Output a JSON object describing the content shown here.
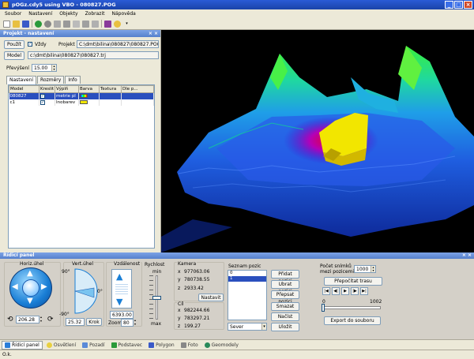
{
  "window": {
    "title": "pOGz.cdy5 using VBO - 080827.POG",
    "controls": [
      "_",
      "□",
      "×"
    ]
  },
  "menu": [
    "Soubor",
    "Nastavení",
    "Objekty",
    "Zobrazit",
    "Nápověda"
  ],
  "project_panel": {
    "title": "Projekt - nastavení",
    "use_button": "Použít",
    "always_label": "Vždy",
    "always_checked": true,
    "project_label": "Projekt",
    "project_path": "C:\\dmt\\bilina\\080827\\080827.POG",
    "model_button": "Model",
    "model_path": "c:\\dmt\\bilina\\080827\\080827.trj",
    "exaggeration_label": "Převýšení",
    "exaggeration_value": "15.00",
    "tabs": [
      "Nastavení",
      "Rozměry",
      "Info"
    ],
    "table": {
      "headers": [
        "Model",
        "Kreslit",
        "Výplň",
        "Barva",
        "Textura",
        "Dle p..."
      ],
      "rows": [
        {
          "model": "080827",
          "draw": true,
          "fill": "metrie pl",
          "color": "rainbow",
          "selected": true
        },
        {
          "model": "c1",
          "draw": true,
          "fill": "Inobarev",
          "color": "#f2e600",
          "selected": false
        }
      ]
    }
  },
  "control_panel": {
    "title": "Řídicí panel",
    "horizontal_angle": {
      "label": "Horiz.úhel",
      "value": "206.28"
    },
    "vertical_angle": {
      "label": "Vert.úhel",
      "value": "25.32",
      "deg_top": "90°",
      "deg_mid": "0°",
      "deg_bottom": "-90°",
      "step_button": "Krok"
    },
    "distance": {
      "label": "Vzdálenost",
      "value": "6393.00",
      "zoom_label": "Zoom",
      "zoom_value": "80"
    },
    "speed": {
      "label": "Rychlost",
      "min": "min",
      "max": "max",
      "level": 0.5
    },
    "camera": {
      "label": "Kamera",
      "x": "977063.06",
      "y": "780738.55",
      "z": "2933.42",
      "set_button": "Nastavit"
    },
    "target": {
      "label": "Cíl",
      "x": "982244.66",
      "y": "783297.21",
      "z": "199.27"
    },
    "positions": {
      "label": "Seznam pozic",
      "items": [
        "0",
        "1"
      ],
      "selected_index": 1,
      "select_value": "Sever"
    },
    "position_buttons": {
      "add": "Přidat pozici",
      "remove": "Ubrat pozici",
      "overwrite": "Přepsat pozici",
      "clear": "Smazat",
      "load": "Načíst",
      "save": "Uložit"
    },
    "animation": {
      "frames_label_1": "Počet snímků",
      "frames_label_2": "mezi pozicemi :",
      "frames_value": "1000",
      "recalc_button": "Přepočítat trasu",
      "slider_min": "0",
      "slider_max": "1002",
      "export_button": "Export do souboru"
    }
  },
  "bottom_tabs": [
    {
      "label": "Řídicí panel",
      "icon": "control-panel-icon",
      "color": "#2a7ed8",
      "active": true
    },
    {
      "label": "Osvětlení",
      "icon": "lightbulb-icon",
      "color": "#e8d040",
      "active": false
    },
    {
      "label": "Pozadí",
      "icon": "background-icon",
      "color": "#5a8ad8",
      "active": false
    },
    {
      "label": "Podstavec",
      "icon": "pedestal-icon",
      "color": "#2a9a3a",
      "active": false
    },
    {
      "label": "Polygon",
      "icon": "polygon-icon",
      "color": "#3a5ac8",
      "active": false
    },
    {
      "label": "Foto",
      "icon": "camera-icon",
      "color": "#888888",
      "active": false
    },
    {
      "label": "Geomodely",
      "icon": "globe-icon",
      "color": "#2a8a5a",
      "active": false
    }
  ],
  "status": "O.k."
}
